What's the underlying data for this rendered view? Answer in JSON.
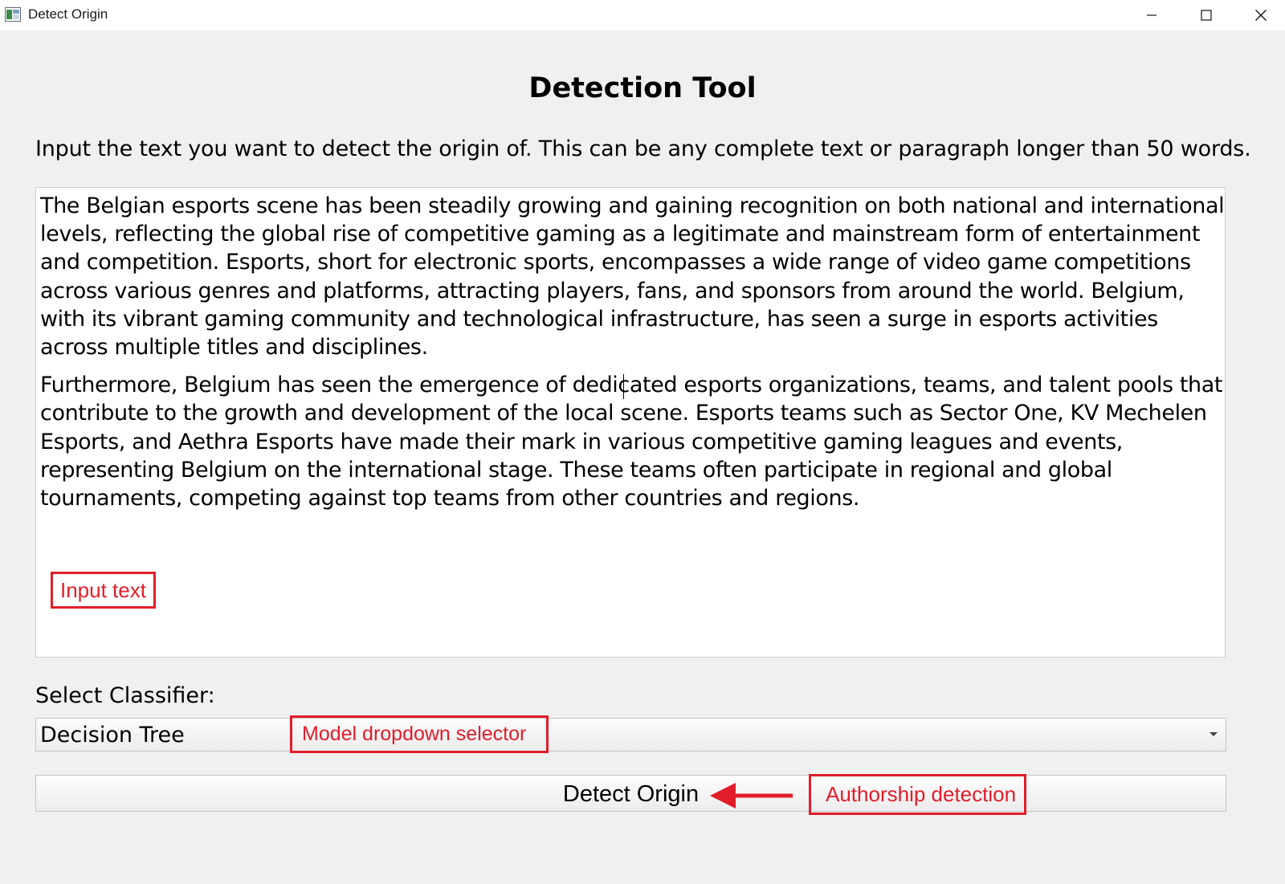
{
  "window": {
    "title": "Detect Origin",
    "icons": [
      "app-icon",
      "minimize-icon",
      "maximize-icon",
      "close-icon"
    ]
  },
  "main": {
    "heading": "Detection Tool",
    "instructions": "Input the text you want to detect the origin of. This can be any complete text or paragraph longer than 50 words.",
    "input_text": {
      "paragraph_1": "The Belgian esports scene has been steadily growing and gaining recognition on both national and international levels, reflecting the global rise of competitive gaming as a legitimate and mainstream form of entertainment and competition. Esports, short for electronic sports, encompasses a wide range of video game competitions across various genres and platforms, attracting players, fans, and sponsors from around the world. Belgium, with its vibrant gaming community and technological infrastructure, has seen a surge in esports activities across multiple titles and disciplines.",
      "paragraph_2": "Furthermore, Belgium has seen the emergence of dedicated esports organizations, teams, and talent pools that contribute to the growth and development of the local scene. Esports teams such as Sector One, KV Mechelen Esports, and Aethra Esports have made their mark in various competitive gaming leagues and events, representing Belgium on the international stage. These teams often participate in regional and global tournaments, competing against top teams from other countries and regions."
    },
    "classifier_label": "Select Classifier:",
    "classifier_selected": "Decision Tree",
    "detect_button": "Detect Origin"
  },
  "annotations": {
    "input_text": "Input text",
    "model_dropdown": "Model dropdown selector",
    "authorship": "Authorship detection",
    "color": "#e21d2a"
  }
}
